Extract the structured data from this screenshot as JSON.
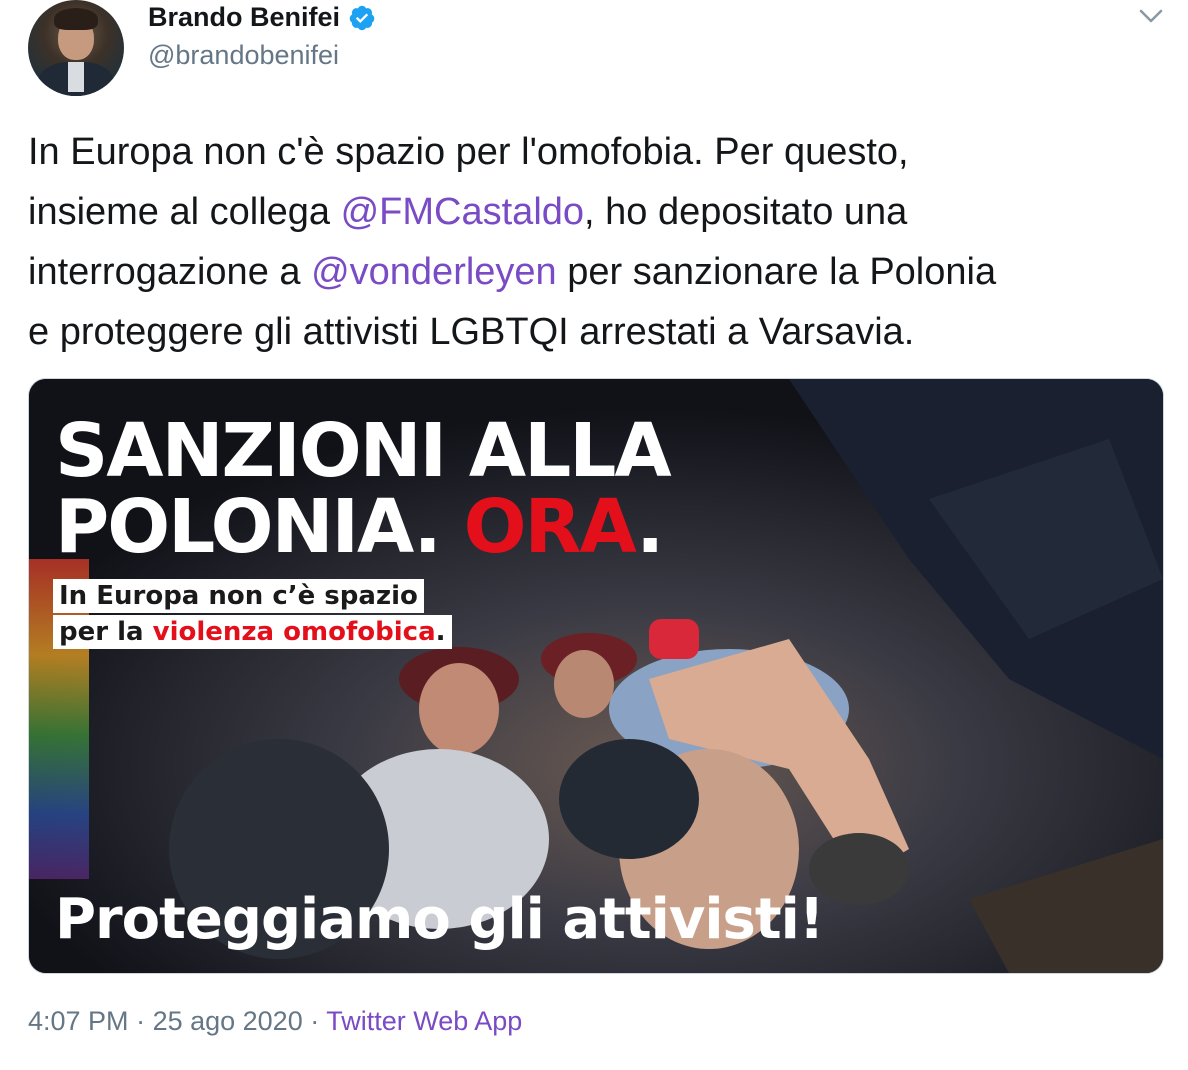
{
  "author": {
    "display_name": "Brando Benifei",
    "handle": "@brandobenifei",
    "verified": true
  },
  "tweet": {
    "text_1": "In Europa non c'è spazio per l'omofobia. Per questo,",
    "text_2": "insieme al collega ",
    "mention_1": "@FMCastaldo",
    "text_3": ", ho depositato una",
    "text_4": "interrogazione a ",
    "mention_2": "@vonderleyen",
    "text_5": " per sanzionare la Polonia",
    "text_6": "e proteggere gli attivisti LGBTQI arrestati a Varsavia."
  },
  "media": {
    "headline_line1": "SANZIONI ALLA",
    "headline_line2_a": "POLONIA. ",
    "headline_line2_b": "ORA",
    "headline_line2_c": ".",
    "sub_line1": "In Europa non c’è spazio",
    "sub_line2_a": "per la ",
    "sub_line2_b": "violenza omofobica",
    "sub_line2_c": ".",
    "slogan": "Proteggiamo gli attivisti!"
  },
  "meta": {
    "time": "4:07 PM",
    "sep1": " · ",
    "date": "25 ago 2020",
    "sep2": " · ",
    "source": "Twitter Web App"
  },
  "colors": {
    "mention": "#794bc4",
    "verified": "#1da1f2",
    "muted": "#657786",
    "accent_red": "#e3101c"
  },
  "icons": {
    "verified": "verified-badge-icon",
    "caret": "chevron-down-icon"
  }
}
